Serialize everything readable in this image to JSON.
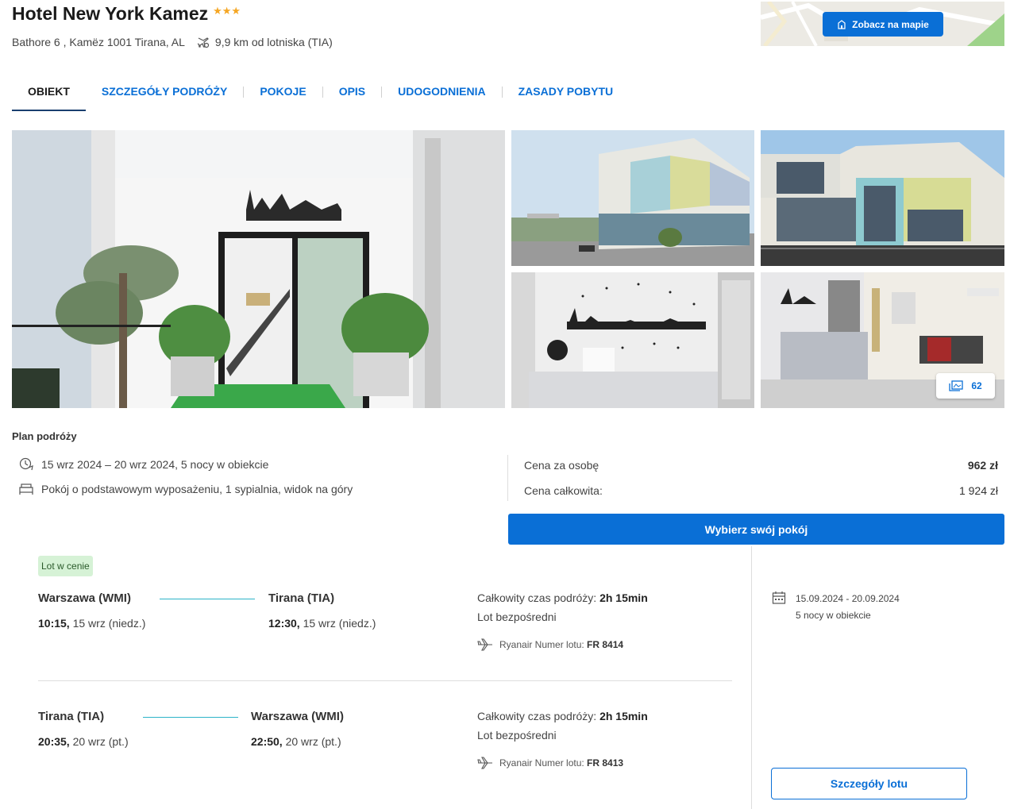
{
  "hotel": {
    "name": "Hotel New York Kamez",
    "stars": "★★★",
    "address": "Bathore 6 , Kamëz 1001 Tirana, AL",
    "airport_distance": "9,9 km od lotniska (TIA)"
  },
  "map": {
    "button_label": "Zobacz na mapie"
  },
  "tabs": [
    {
      "label": "OBIEKT",
      "active": true
    },
    {
      "label": "SZCZEGÓŁY PODRÓŻY"
    },
    {
      "label": "POKOJE"
    },
    {
      "label": "OPIS"
    },
    {
      "label": "UDOGODNIENIA"
    },
    {
      "label": "ZASADY POBYTU"
    }
  ],
  "gallery": {
    "photo_count": "62"
  },
  "plan": {
    "title": "Plan podróży",
    "dates": "15 wrz 2024 – 20 wrz 2024, 5 nocy w obiekcie",
    "room": "Pokój o podstawowym wyposażeniu, 1 sypialnia, widok na góry",
    "price_per_person_label": "Cena za osobę",
    "price_per_person": "962 zł",
    "total_price_label": "Cena całkowita:",
    "total_price": "1 924 zł",
    "select_room_button": "Wybierz swój pokój"
  },
  "flights": {
    "badge": "Lot w cenie",
    "outbound": {
      "from": "Warszawa (WMI)",
      "to": "Tirana (TIA)",
      "dep_time": "10:15,",
      "dep_date": " 15 wrz (niedz.)",
      "arr_time": "12:30,",
      "arr_date": " 15 wrz (niedz.)",
      "duration_label": "Całkowity czas podróży: ",
      "duration": "2h 15min",
      "type": "Lot bezpośredni",
      "flight_label": "Ryanair Numer lotu: ",
      "flight_number": "FR 8414"
    },
    "return": {
      "from": "Tirana (TIA)",
      "to": "Warszawa (WMI)",
      "dep_time": "20:35,",
      "dep_date": " 20 wrz (pt.)",
      "arr_time": "22:50,",
      "arr_date": " 20 wrz (pt.)",
      "duration_label": "Całkowity czas podróży: ",
      "duration": "2h 15min",
      "type": "Lot bezpośredni",
      "flight_label": "Ryanair Numer lotu: ",
      "flight_number": "FR 8413"
    },
    "dates_range": "15.09.2024 - 20.09.2024",
    "nights": "5 nocy w obiekcie",
    "details_button": "Szczegóły lotu"
  },
  "icons": {
    "airport": "airport-distance-icon",
    "map": "map-pin-icon",
    "calendar": "calendar-icon",
    "bed": "bed-icon",
    "plane": "plane-icon",
    "gallery": "gallery-icon"
  },
  "colors": {
    "accent": "#0a6fd6",
    "star": "#f5a623",
    "route": "#2cb3c8",
    "badge_bg": "#d6f2d6"
  }
}
